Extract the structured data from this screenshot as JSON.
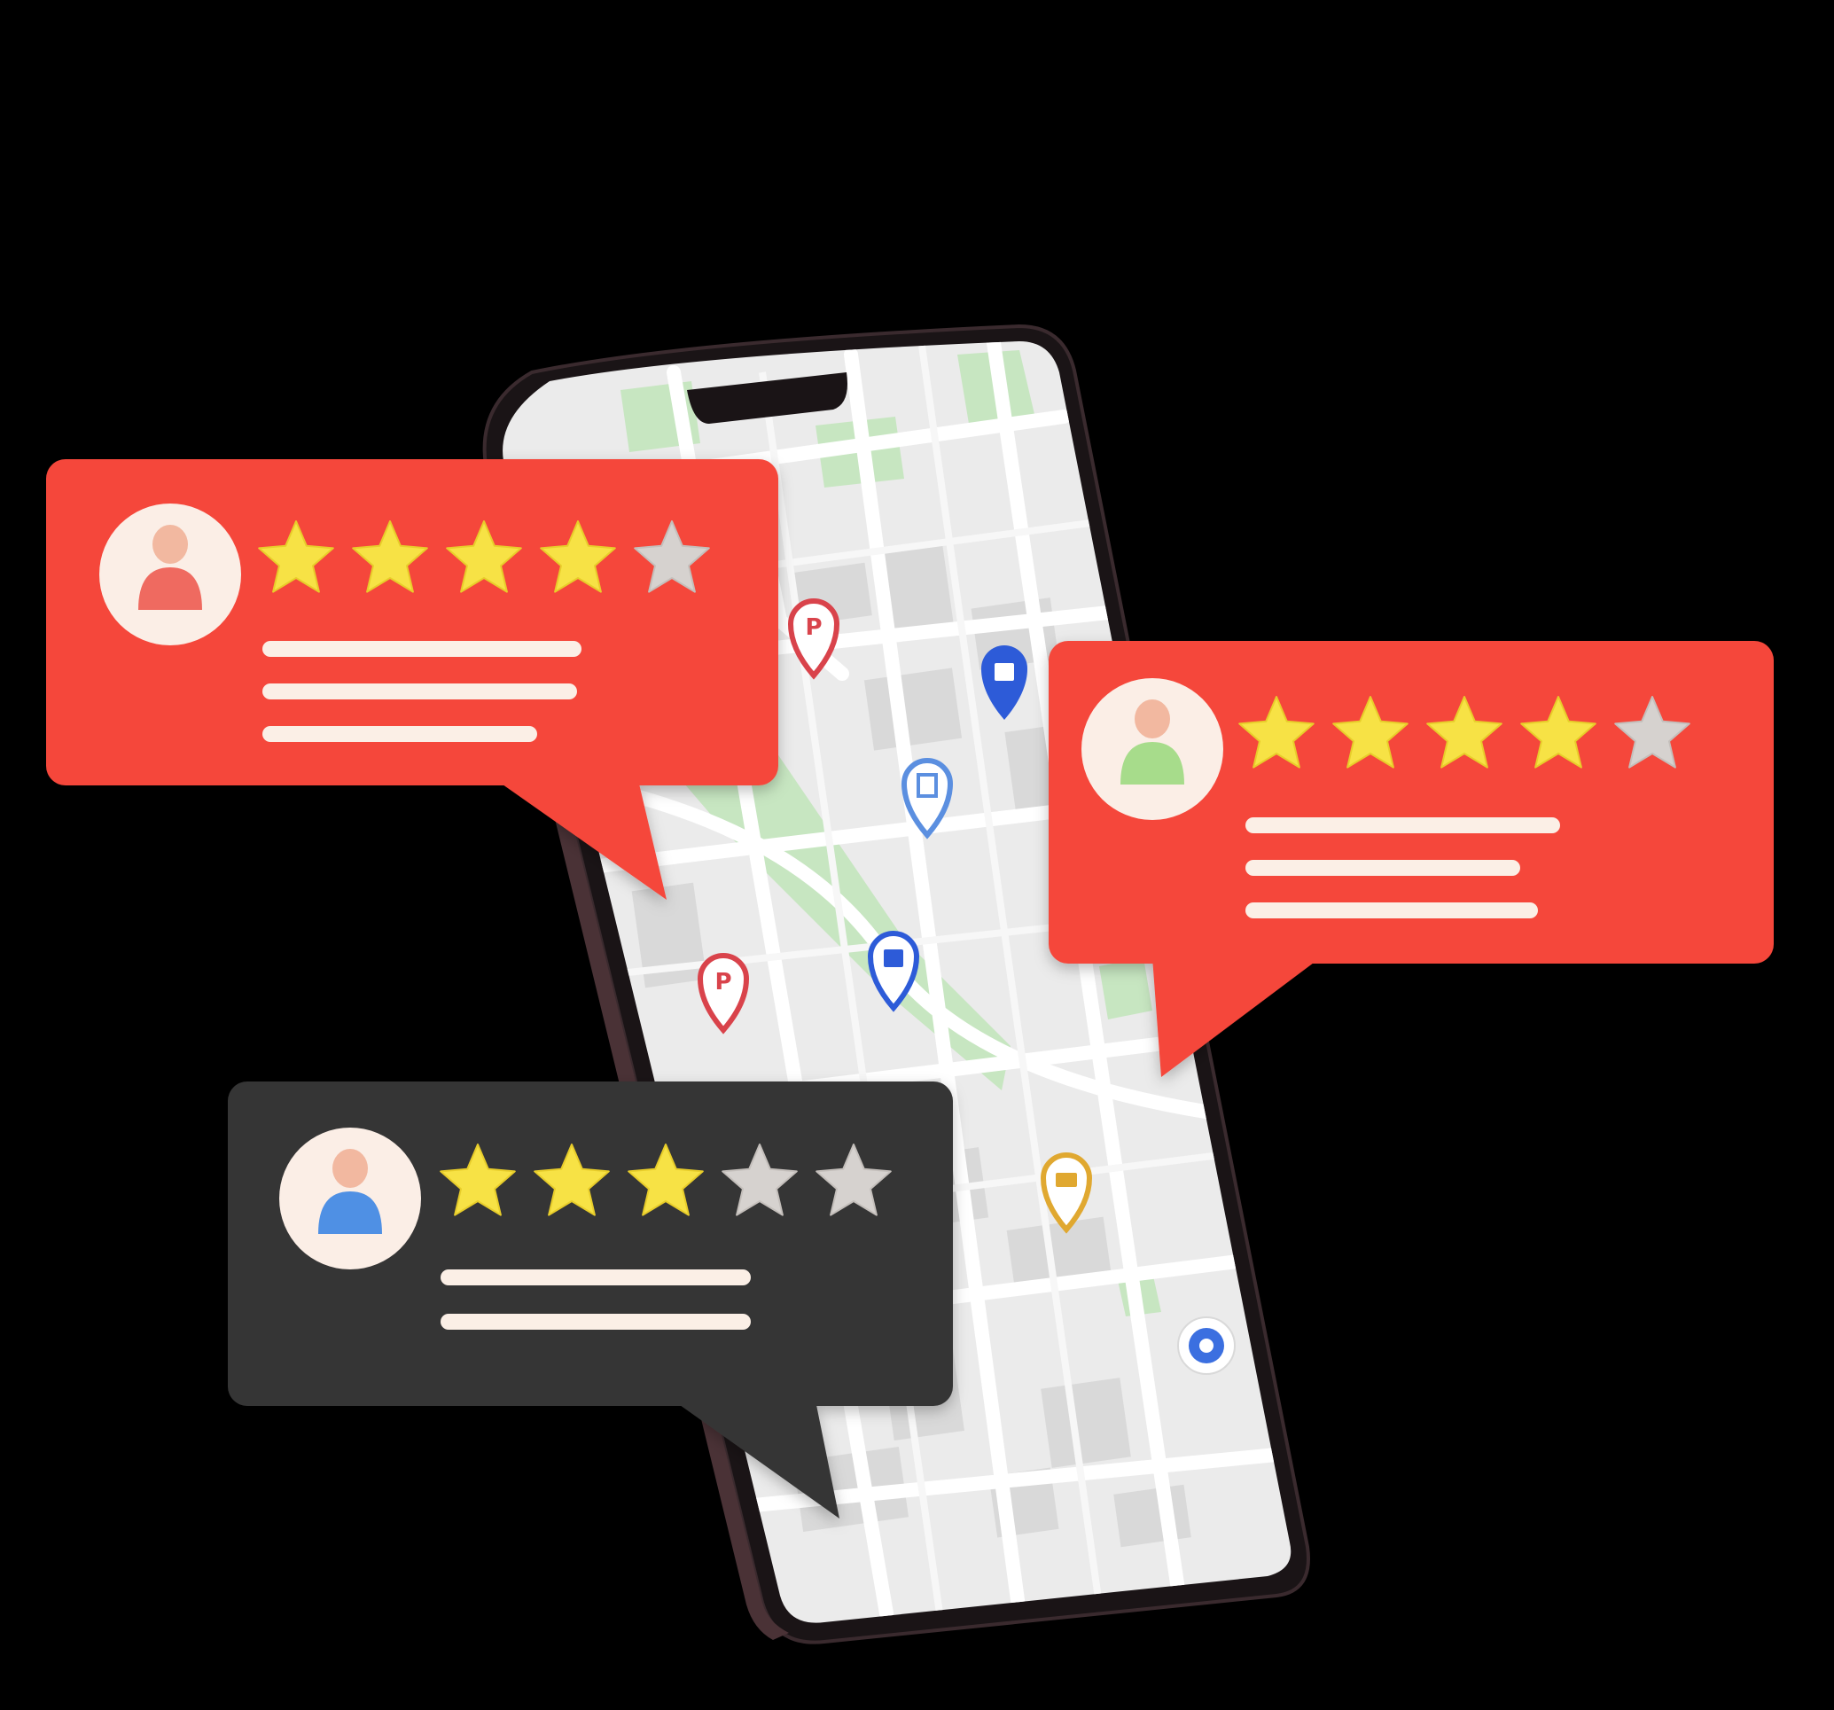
{
  "colors": {
    "background": "#000000",
    "bubble_red": "#f5473b",
    "bubble_dark": "#363636",
    "star_filled": "#f7e244",
    "star_empty": "#d6d2cf",
    "text_line": "#fbefe6",
    "map_base": "#ebebeb",
    "map_road": "#ffffff",
    "map_park": "#c7e6c1",
    "map_block": "#d9d9d9",
    "phone_frame": "#1a1416",
    "pin_parking": "#d9434b",
    "pin_shop": "#2d5bd8",
    "pin_cinema": "#5b8fe0",
    "pin_basket": "#e0a830",
    "pin_location": "#3b6fe0"
  },
  "reviews": [
    {
      "id": "review-top-left",
      "style": "red",
      "avatar": {
        "icon": "person-icon",
        "body_color": "#ef6b60"
      },
      "rating": 4,
      "max_rating": 5,
      "text_lines": 3
    },
    {
      "id": "review-right",
      "style": "red",
      "avatar": {
        "icon": "person-icon",
        "body_color": "#a7dc8b"
      },
      "rating": 4,
      "max_rating": 5,
      "text_lines": 3
    },
    {
      "id": "review-bottom",
      "style": "dark",
      "avatar": {
        "icon": "person-icon",
        "body_color": "#4f90e4"
      },
      "rating": 3,
      "max_rating": 5,
      "text_lines": 2
    }
  ],
  "map_pins": [
    {
      "icon": "parking-pin-icon",
      "color": "#d9434b"
    },
    {
      "icon": "shopping-bag-pin-icon",
      "color": "#2d5bd8"
    },
    {
      "icon": "cinema-pin-icon",
      "color": "#5b8fe0"
    },
    {
      "icon": "parking-pin-icon",
      "color": "#d9434b"
    },
    {
      "icon": "shopping-bag-pin-icon",
      "color": "#2d5bd8"
    },
    {
      "icon": "shopping-basket-pin-icon",
      "color": "#e0a830"
    },
    {
      "icon": "current-location-icon",
      "color": "#3b6fe0"
    }
  ]
}
